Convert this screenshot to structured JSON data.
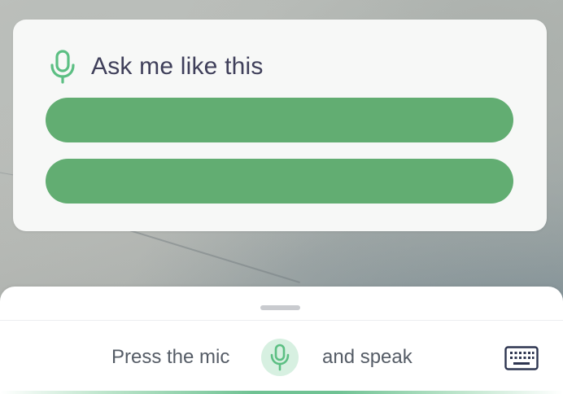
{
  "suggestion_card": {
    "title": "Ask me like this",
    "suggestions": [
      {
        "label": ""
      },
      {
        "label": ""
      }
    ]
  },
  "bottom_sheet": {
    "prompt_before": "Press the mic",
    "prompt_after": "and speak"
  },
  "icons": {
    "card_mic": "microphone-icon",
    "mic_button": "microphone-icon",
    "keyboard": "keyboard-icon"
  },
  "colors": {
    "accent_green": "#62ad72",
    "mic_green": "#5cbf83",
    "mic_bg": "#d7f0e1",
    "title_text": "#3f3f5a",
    "keyboard_icon": "#2d3550"
  }
}
